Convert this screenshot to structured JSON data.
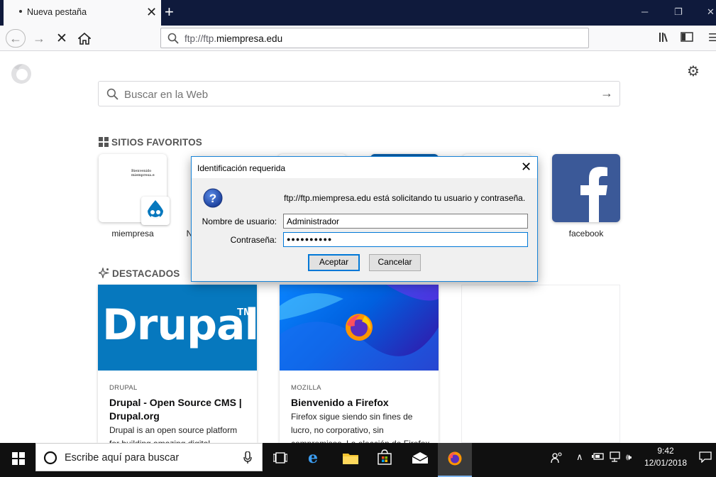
{
  "browser": {
    "tab_title": "Nueva pestaña",
    "url_prefix": "ftp://ftp.",
    "url_domain": "miempresa.edu"
  },
  "newtab": {
    "search_placeholder": "Buscar en la Web",
    "top_sites_heading": "SITIOS FAVORITOS",
    "highlights_heading": "DESTACADOS",
    "sites": [
      {
        "label": "miempresa",
        "thumb_text": "Bienvenido miempresa.e"
      },
      {
        "label": "N"
      },
      {
        "label": "facebook"
      }
    ],
    "cards": [
      {
        "image_text": "Drupal",
        "trademark": "TM",
        "source": "DRUPAL",
        "title": "Drupal - Open Source CMS | Drupal.org",
        "desc": "Drupal is an open source platform for building amazing digital"
      },
      {
        "source": "MOZILLA",
        "title": "Bienvenido a Firefox",
        "desc": "Firefox sigue siendo sin fines de lucro, no corporativo, sin compromisos. La elección de Firefox"
      }
    ]
  },
  "dialog": {
    "title": "Identificación requerida",
    "message": "ftp://ftp.miempresa.edu está solicitando tu usuario y contraseña.",
    "username_label": "Nombre de usuario:",
    "username_value": "Administrador",
    "password_label": "Contraseña:",
    "password_value": "●●●●●●●●●●",
    "ok_label": "Aceptar",
    "cancel_label": "Cancelar"
  },
  "taskbar": {
    "search_placeholder": "Escribe aquí para buscar",
    "time": "9:42",
    "date": "12/01/2018"
  },
  "colors": {
    "drupal_blue": "#0678be",
    "facebook_blue": "#3b5998",
    "dialog_focus": "#0078d7",
    "titlebar": "#0f1a3c"
  }
}
